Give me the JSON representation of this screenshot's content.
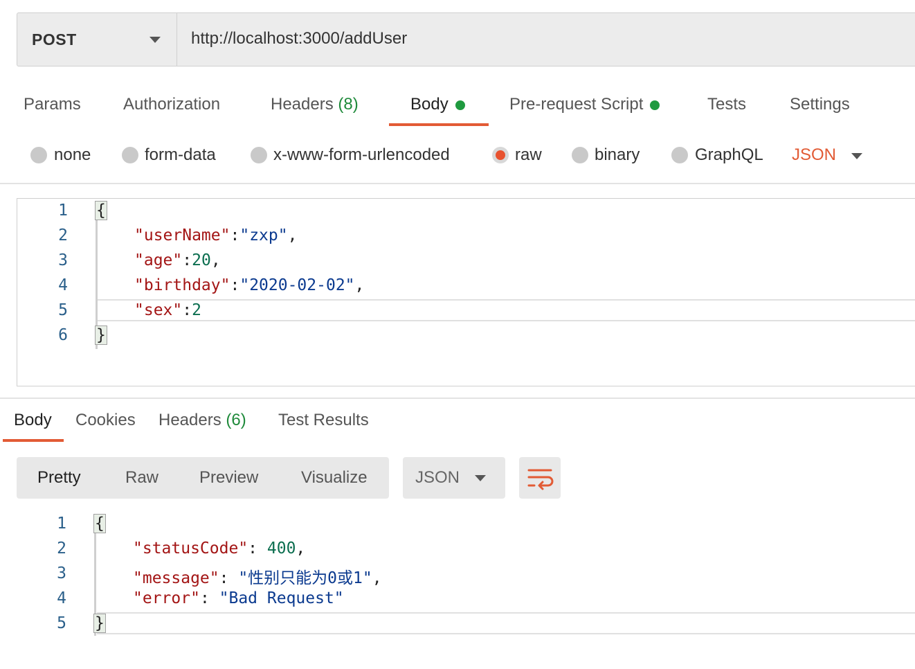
{
  "request": {
    "method": "POST",
    "url": "http://localhost:3000/addUser"
  },
  "request_tabs": {
    "params": "Params",
    "authorization": "Authorization",
    "headers": "Headers",
    "headers_count": "(8)",
    "body": "Body",
    "prerequest": "Pre-request Script",
    "tests": "Tests",
    "settings": "Settings"
  },
  "body_types": {
    "none": "none",
    "form_data": "form-data",
    "urlencoded": "x-www-form-urlencoded",
    "raw": "raw",
    "binary": "binary",
    "graphql": "GraphQL",
    "format": "JSON",
    "selected": "raw"
  },
  "request_body": {
    "line_numbers": [
      "1",
      "2",
      "3",
      "4",
      "5",
      "6"
    ],
    "open": "{",
    "l2_key": "\"userName\"",
    "l2_sep": ":",
    "l2_val": "\"zxp\"",
    "l2_end": ",",
    "l3_key": "\"age\"",
    "l3_sep": ":",
    "l3_val": "20",
    "l3_end": ",",
    "l4_key": "\"birthday\"",
    "l4_sep": ":",
    "l4_val": "\"2020-02-02\"",
    "l4_end": ",",
    "l5_key": "\"sex\"",
    "l5_sep": ":",
    "l5_val": "2",
    "close": "}"
  },
  "response_tabs": {
    "body": "Body",
    "cookies": "Cookies",
    "headers": "Headers",
    "headers_count": "(6)",
    "test_results": "Test Results"
  },
  "view_modes": {
    "pretty": "Pretty",
    "raw": "Raw",
    "preview": "Preview",
    "visualize": "Visualize",
    "format": "JSON"
  },
  "response_body": {
    "line_numbers": [
      "1",
      "2",
      "3",
      "4",
      "5"
    ],
    "open": "{",
    "l2_key": "\"statusCode\"",
    "l2_sep": ": ",
    "l2_val": "400",
    "l2_end": ",",
    "l3_key": "\"message\"",
    "l3_sep": ": ",
    "l3_val": "\"性别只能为0或1\"",
    "l3_end": ",",
    "l4_key": "\"error\"",
    "l4_sep": ": ",
    "l4_val": "\"Bad Request\"",
    "close": "}"
  },
  "colors": {
    "accent": "#e25b35",
    "indicator_green": "#1f9a3f",
    "json_key": "#a31515",
    "json_string": "#0b3a8f",
    "json_number": "#0b6e4f"
  },
  "icons": {
    "method_dropdown": "caret-down-icon",
    "format_dropdown": "caret-down-icon",
    "wrap": "wrap-lines-icon"
  }
}
